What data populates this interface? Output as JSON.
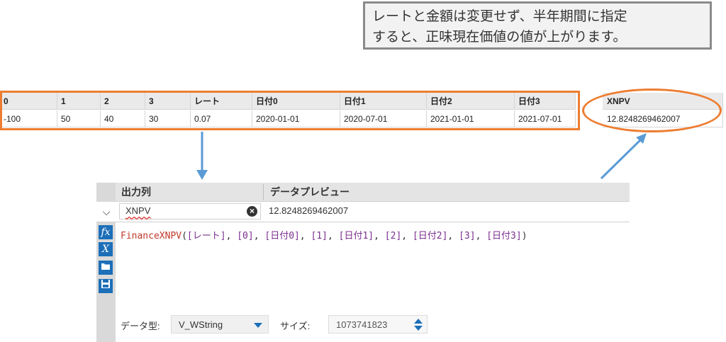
{
  "note": {
    "line1": "レートと金額は変更せず、半年期間に指定",
    "line2": "すると、正味現在価値の値が上がります。"
  },
  "grid": {
    "headers": [
      "0",
      "1",
      "2",
      "3",
      "レート",
      "日付0",
      "日付1",
      "日付2",
      "日付3",
      "XNPV"
    ],
    "values": [
      "-100",
      "50",
      "40",
      "30",
      "0.07",
      "2020-01-01",
      "2020-07-01",
      "2021-01-01",
      "2021-07-01",
      "12.8248269462007"
    ]
  },
  "panel": {
    "header_output": "出力列",
    "header_preview": "データプレビュー",
    "field_name": "XNPV",
    "preview_value": "12.8248269462007",
    "tools": [
      "fx-icon",
      "variable-x-icon",
      "open-folder-icon",
      "save-icon"
    ],
    "formula": {
      "fn": "FinanceXNPV",
      "open": "(",
      "args": [
        "[レート]",
        "[0]",
        "[日付0]",
        "[1]",
        "[日付1]",
        "[2]",
        "[日付2]",
        "[3]",
        "[日付3]"
      ],
      "sep": ", ",
      "close": ")"
    },
    "datatype_label": "データ型:",
    "datatype_value": "V_WString",
    "size_label": "サイズ:",
    "size_value": "1073741823"
  },
  "colors": {
    "highlight": "#ed7d31",
    "arrow": "#5b9bd5",
    "accent": "#1c6fb8"
  }
}
